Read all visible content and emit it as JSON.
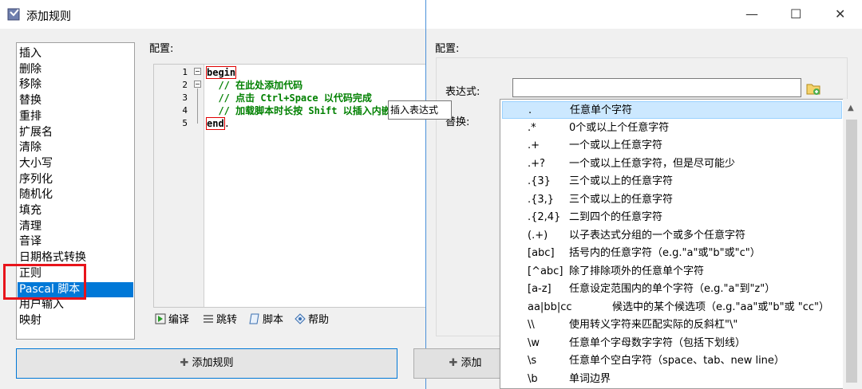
{
  "left_dialog": {
    "title": "添加规则",
    "rules": [
      "插入",
      "删除",
      "移除",
      "替换",
      "重排",
      "扩展名",
      "清除",
      "大小写",
      "序列化",
      "随机化",
      "填充",
      "清理",
      "音译",
      "日期格式转换",
      "正则",
      "Pascal 脚本",
      "用户输入",
      "映射"
    ],
    "selected_rule": "Pascal 脚本",
    "config_label": "配置:",
    "code_lines": [
      {
        "num": "1",
        "kw": "begin",
        "rest": ""
      },
      {
        "num": "2",
        "comment": "  // 在此处添加代码"
      },
      {
        "num": "3",
        "comment": "  // 点击 Ctrl+Space 以代码完成"
      },
      {
        "num": "4",
        "comment": "  // 加载脚本时长按 Shift 以插入内嵌"
      },
      {
        "num": "5",
        "kw": "end",
        "rest": "."
      }
    ],
    "toolbar": {
      "compile": "编译",
      "goto": "跳转",
      "script": "脚本",
      "help": "帮助"
    },
    "add_rule_button": "添加规则"
  },
  "right_dialog": {
    "config_label": "配置:",
    "expression_label": "表达式:",
    "expression_value": "",
    "replace_label": "替换:",
    "tooltip": "插入表达式",
    "add_button": "添加"
  },
  "regex_menu": [
    {
      "pattern": ".",
      "desc": "任意单个字符"
    },
    {
      "pattern": ".*",
      "desc": "0个或以上个任意字符"
    },
    {
      "pattern": ".+",
      "desc": "一个或以上任意字符"
    },
    {
      "pattern": ".+?",
      "desc": "一个或以上任意字符，但是尽可能少"
    },
    {
      "pattern": ".{3}",
      "desc": "三个或以上的任意字符"
    },
    {
      "pattern": ".{3,}",
      "desc": "三个或以上的任意字符"
    },
    {
      "pattern": ".{2,4}",
      "desc": "二到四个的任意字符"
    },
    {
      "pattern": "(.+)",
      "desc": "以子表达式分组的一个或多个任意字符"
    },
    {
      "pattern": "[abc]",
      "desc": "括号内的任意字符（e.g.\"a\"或\"b\"或\"c\"）"
    },
    {
      "pattern": "[^abc]",
      "desc": "除了排除项外的任意单个字符"
    },
    {
      "pattern": "[a-z]",
      "desc": "任意设定范围内的单个字符（e.g.\"a\"到\"z\"）"
    },
    {
      "pattern": "aa|bb|cc",
      "desc": "候选中的某个候选项（e.g.\"aa\"或\"b\"或 \"cc\"）"
    },
    {
      "pattern": "\\\\",
      "desc": "使用转义字符来匹配实际的反斜杠\"\\\""
    },
    {
      "pattern": "\\w",
      "desc": "任意单个字母数字字符（包括下划线）"
    },
    {
      "pattern": "\\s",
      "desc": "任意单个空白字符（space、tab、new line）"
    },
    {
      "pattern": "\\b",
      "desc": "单词边界"
    }
  ],
  "colors": {
    "selection": "#0078d7",
    "highlight_row": "#cce8ff",
    "red_box": "#e8141b",
    "comment": "#008000"
  }
}
